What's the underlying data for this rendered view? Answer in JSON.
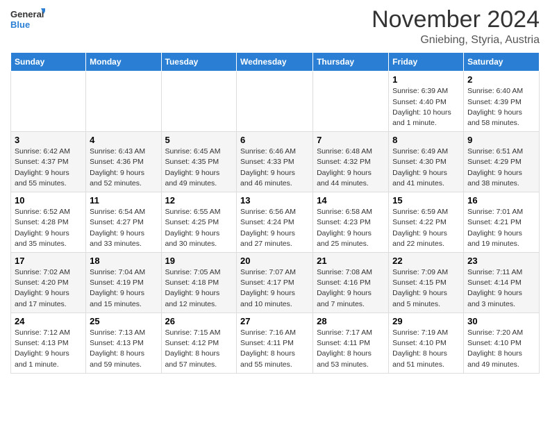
{
  "header": {
    "logo": {
      "line1": "General",
      "line2": "Blue"
    },
    "title": "November 2024",
    "location": "Gniebing, Styria, Austria"
  },
  "weekdays": [
    "Sunday",
    "Monday",
    "Tuesday",
    "Wednesday",
    "Thursday",
    "Friday",
    "Saturday"
  ],
  "weeks": [
    [
      {
        "day": "",
        "info": ""
      },
      {
        "day": "",
        "info": ""
      },
      {
        "day": "",
        "info": ""
      },
      {
        "day": "",
        "info": ""
      },
      {
        "day": "",
        "info": ""
      },
      {
        "day": "1",
        "info": "Sunrise: 6:39 AM\nSunset: 4:40 PM\nDaylight: 10 hours\nand 1 minute."
      },
      {
        "day": "2",
        "info": "Sunrise: 6:40 AM\nSunset: 4:39 PM\nDaylight: 9 hours\nand 58 minutes."
      }
    ],
    [
      {
        "day": "3",
        "info": "Sunrise: 6:42 AM\nSunset: 4:37 PM\nDaylight: 9 hours\nand 55 minutes."
      },
      {
        "day": "4",
        "info": "Sunrise: 6:43 AM\nSunset: 4:36 PM\nDaylight: 9 hours\nand 52 minutes."
      },
      {
        "day": "5",
        "info": "Sunrise: 6:45 AM\nSunset: 4:35 PM\nDaylight: 9 hours\nand 49 minutes."
      },
      {
        "day": "6",
        "info": "Sunrise: 6:46 AM\nSunset: 4:33 PM\nDaylight: 9 hours\nand 46 minutes."
      },
      {
        "day": "7",
        "info": "Sunrise: 6:48 AM\nSunset: 4:32 PM\nDaylight: 9 hours\nand 44 minutes."
      },
      {
        "day": "8",
        "info": "Sunrise: 6:49 AM\nSunset: 4:30 PM\nDaylight: 9 hours\nand 41 minutes."
      },
      {
        "day": "9",
        "info": "Sunrise: 6:51 AM\nSunset: 4:29 PM\nDaylight: 9 hours\nand 38 minutes."
      }
    ],
    [
      {
        "day": "10",
        "info": "Sunrise: 6:52 AM\nSunset: 4:28 PM\nDaylight: 9 hours\nand 35 minutes."
      },
      {
        "day": "11",
        "info": "Sunrise: 6:54 AM\nSunset: 4:27 PM\nDaylight: 9 hours\nand 33 minutes."
      },
      {
        "day": "12",
        "info": "Sunrise: 6:55 AM\nSunset: 4:25 PM\nDaylight: 9 hours\nand 30 minutes."
      },
      {
        "day": "13",
        "info": "Sunrise: 6:56 AM\nSunset: 4:24 PM\nDaylight: 9 hours\nand 27 minutes."
      },
      {
        "day": "14",
        "info": "Sunrise: 6:58 AM\nSunset: 4:23 PM\nDaylight: 9 hours\nand 25 minutes."
      },
      {
        "day": "15",
        "info": "Sunrise: 6:59 AM\nSunset: 4:22 PM\nDaylight: 9 hours\nand 22 minutes."
      },
      {
        "day": "16",
        "info": "Sunrise: 7:01 AM\nSunset: 4:21 PM\nDaylight: 9 hours\nand 19 minutes."
      }
    ],
    [
      {
        "day": "17",
        "info": "Sunrise: 7:02 AM\nSunset: 4:20 PM\nDaylight: 9 hours\nand 17 minutes."
      },
      {
        "day": "18",
        "info": "Sunrise: 7:04 AM\nSunset: 4:19 PM\nDaylight: 9 hours\nand 15 minutes."
      },
      {
        "day": "19",
        "info": "Sunrise: 7:05 AM\nSunset: 4:18 PM\nDaylight: 9 hours\nand 12 minutes."
      },
      {
        "day": "20",
        "info": "Sunrise: 7:07 AM\nSunset: 4:17 PM\nDaylight: 9 hours\nand 10 minutes."
      },
      {
        "day": "21",
        "info": "Sunrise: 7:08 AM\nSunset: 4:16 PM\nDaylight: 9 hours\nand 7 minutes."
      },
      {
        "day": "22",
        "info": "Sunrise: 7:09 AM\nSunset: 4:15 PM\nDaylight: 9 hours\nand 5 minutes."
      },
      {
        "day": "23",
        "info": "Sunrise: 7:11 AM\nSunset: 4:14 PM\nDaylight: 9 hours\nand 3 minutes."
      }
    ],
    [
      {
        "day": "24",
        "info": "Sunrise: 7:12 AM\nSunset: 4:13 PM\nDaylight: 9 hours\nand 1 minute."
      },
      {
        "day": "25",
        "info": "Sunrise: 7:13 AM\nSunset: 4:13 PM\nDaylight: 8 hours\nand 59 minutes."
      },
      {
        "day": "26",
        "info": "Sunrise: 7:15 AM\nSunset: 4:12 PM\nDaylight: 8 hours\nand 57 minutes."
      },
      {
        "day": "27",
        "info": "Sunrise: 7:16 AM\nSunset: 4:11 PM\nDaylight: 8 hours\nand 55 minutes."
      },
      {
        "day": "28",
        "info": "Sunrise: 7:17 AM\nSunset: 4:11 PM\nDaylight: 8 hours\nand 53 minutes."
      },
      {
        "day": "29",
        "info": "Sunrise: 7:19 AM\nSunset: 4:10 PM\nDaylight: 8 hours\nand 51 minutes."
      },
      {
        "day": "30",
        "info": "Sunrise: 7:20 AM\nSunset: 4:10 PM\nDaylight: 8 hours\nand 49 minutes."
      }
    ]
  ]
}
